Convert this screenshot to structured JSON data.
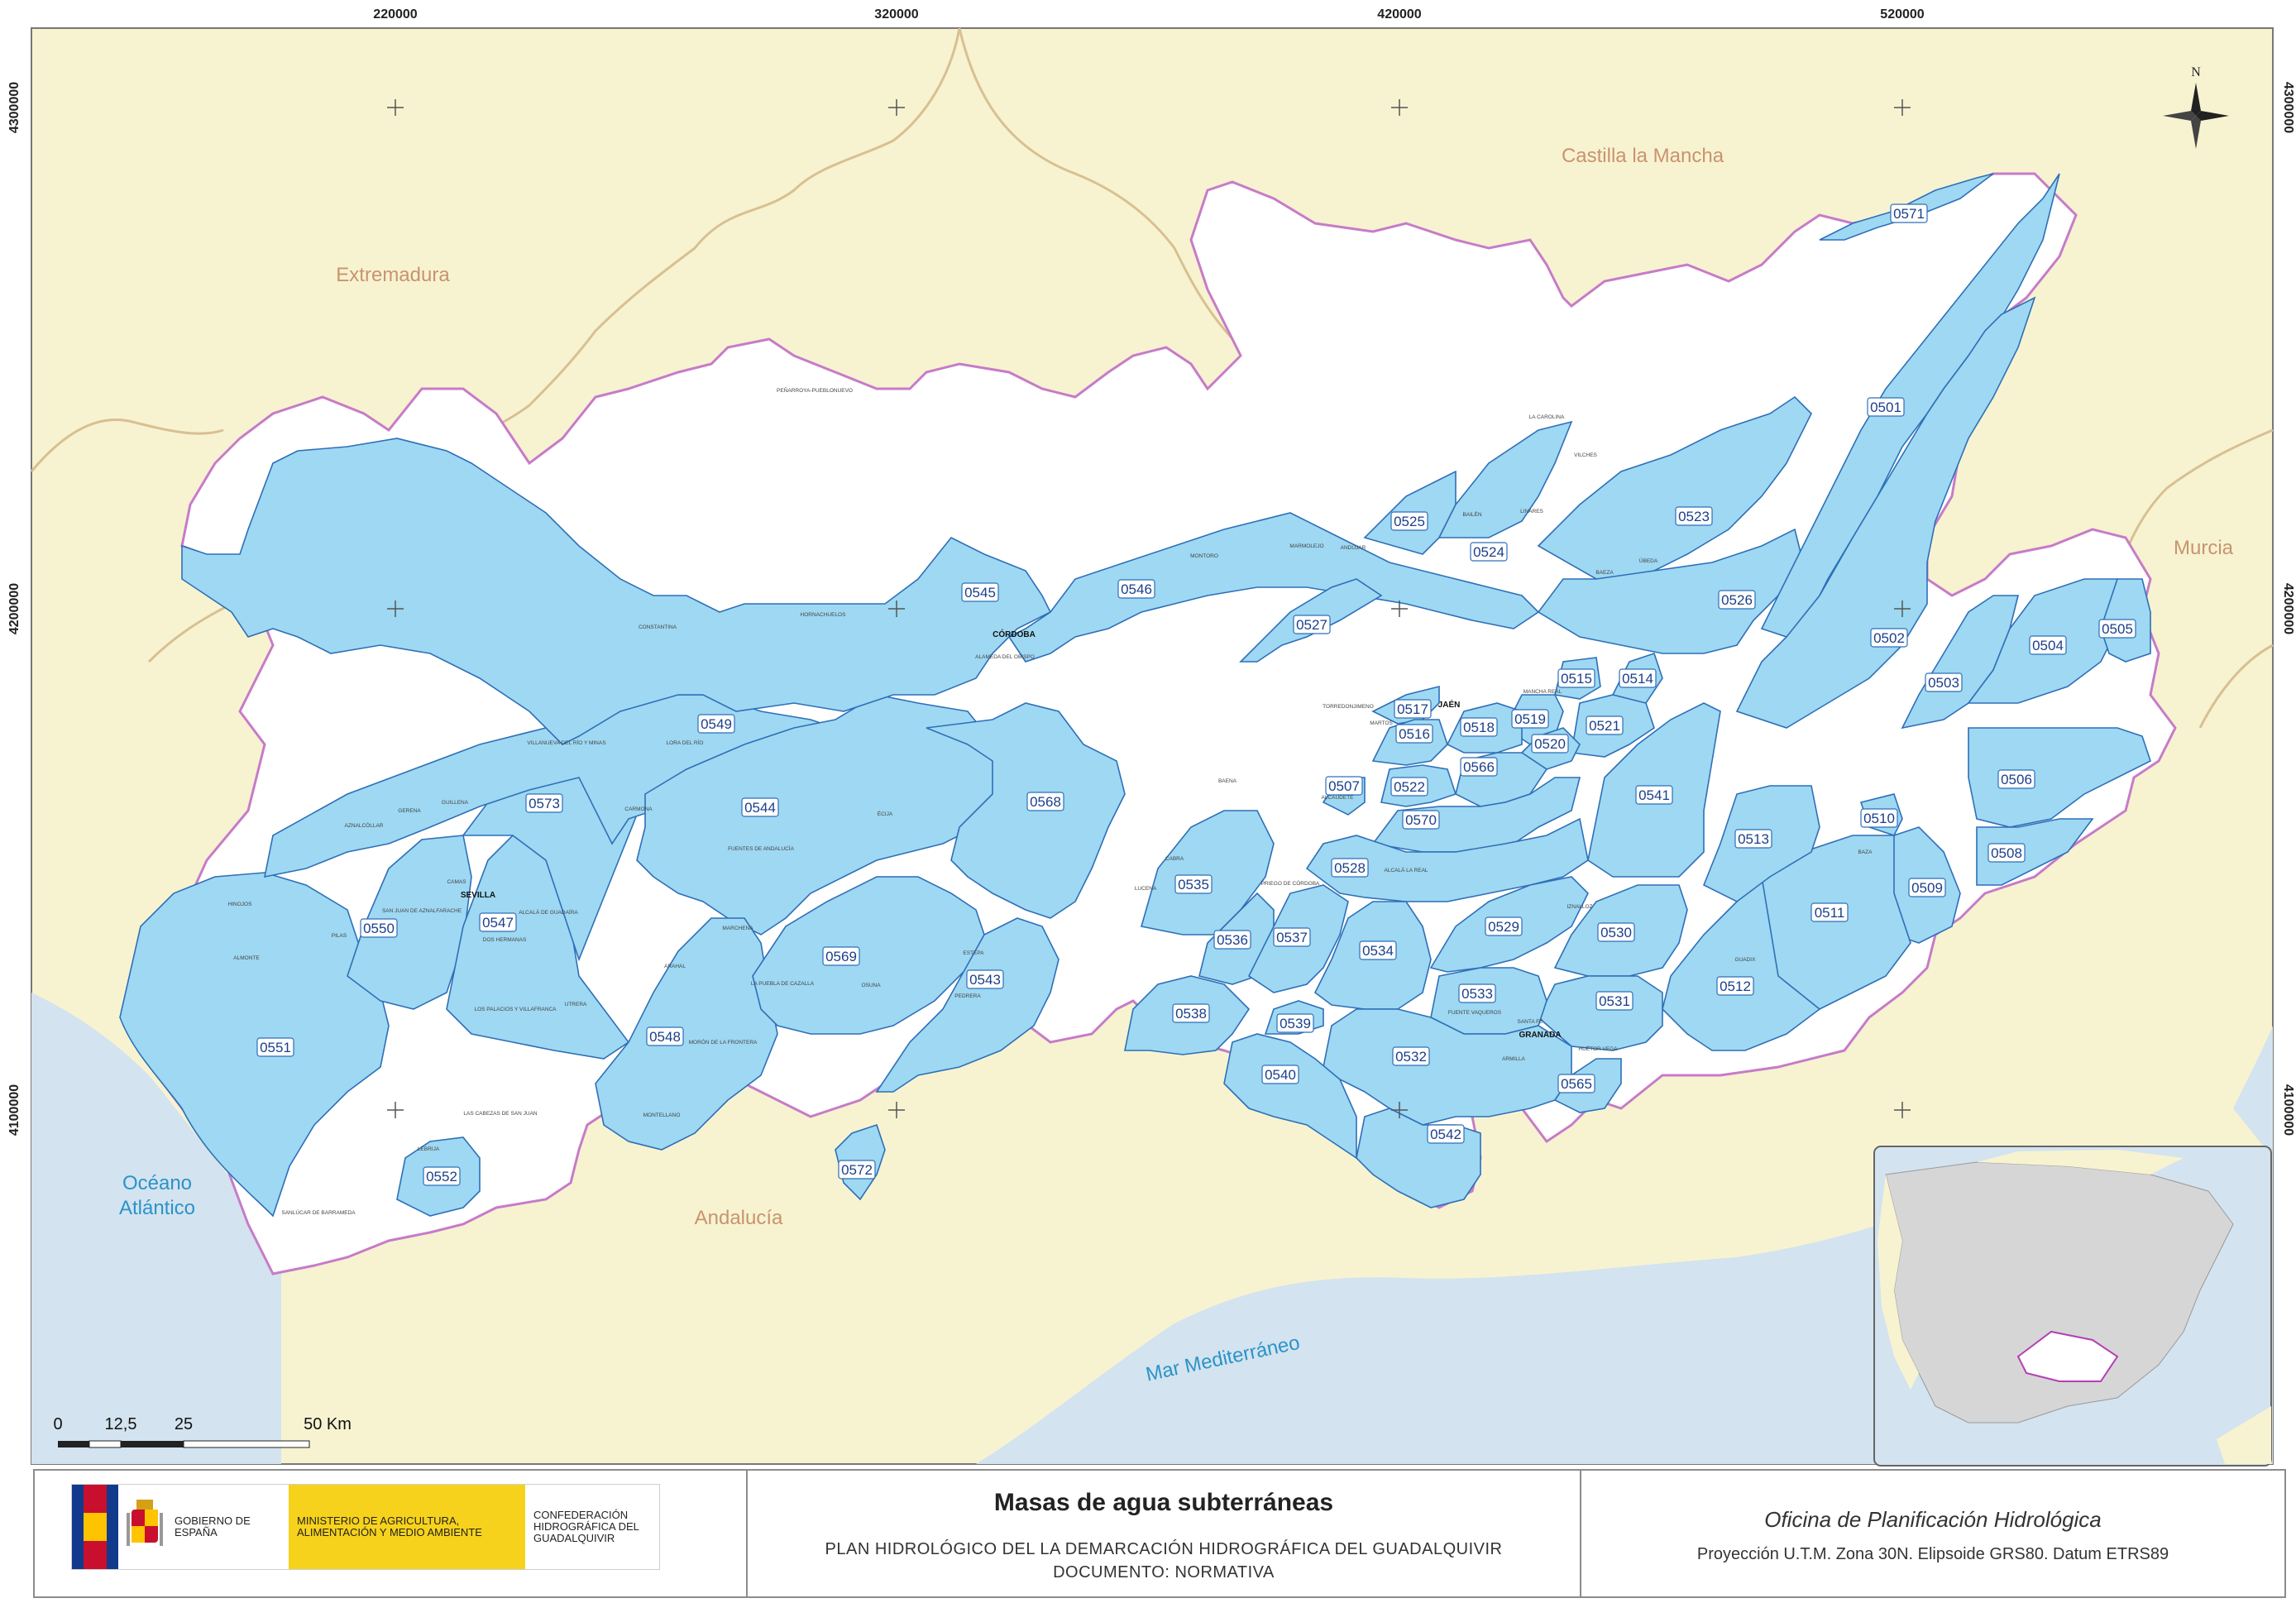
{
  "grid": {
    "eastings": [
      "220000",
      "320000",
      "420000",
      "520000"
    ],
    "northings": [
      "4300000",
      "4200000",
      "4100000"
    ]
  },
  "regions": {
    "extremadura": "Extremadura",
    "castilla": "Castilla la Mancha",
    "murcia": "Murcia",
    "andalucia": "Andalucía"
  },
  "seas": {
    "atlantico_1": "Océano",
    "atlantico_2": "Atlántico",
    "mediterraneo": "Mar Mediterráneo"
  },
  "north_label": "N",
  "cities": {
    "cordoba": "CÓRDOBA",
    "sevilla": "SEVILLA",
    "jaen": "JAÉN",
    "granada": "GRANADA"
  },
  "towns": {
    "penarroya": "PEÑARROYA-PUEBLONUEVO",
    "constantina": "CONSTANTINA",
    "hornachuelos": "HORNACHUELOS",
    "alameda": "ALAMEDA DEL OBISPO",
    "montoro": "MONTORO",
    "marmolejo": "MARMOLEJO",
    "andujar": "ANDÚJAR",
    "bailen": "BAILÉN",
    "linares": "LINARES",
    "carolina": "LA CAROLINA",
    "vilches": "VILCHES",
    "baeza": "BAEZA",
    "ubeda": "ÚBEDA",
    "torredonjimeno": "TORREDONJIMENO",
    "martos": "MARTOS",
    "mancha_real": "MANCHA REAL",
    "ecija": "ÉCIJA",
    "fuentes": "FUENTES DE ANDALUCÍA",
    "carmona": "CARMONA",
    "lora": "LORA DEL RÍO",
    "villanueva": "VILLANUEVA DEL RÍO Y MINAS",
    "gerena": "GERENA",
    "guillena": "GUILLENA",
    "aznalcollar": "AZNALCÓLLAR",
    "hinojos": "HINOJOS",
    "pilas": "PILAS",
    "almonte": "ALMONTE",
    "camas": "CAMAS",
    "san_juan": "SAN JUAN DE AZNALFARACHE",
    "alcala_guadaira": "ALCALÁ DE GUADAÍRA",
    "dos_hermanas": "DOS HERMANAS",
    "los_palacios": "LOS PALACIOS Y VILLAFRANCA",
    "utrera": "UTRERA",
    "arahal": "ARAHAL",
    "marchena": "MARCHENA",
    "osuna": "OSUNA",
    "estepa": "ESTEPA",
    "pedrera": "PEDRERA",
    "moron": "MORÓN DE LA FRONTERA",
    "montellano": "MONTELLANO",
    "cabezas": "LAS CABEZAS DE SAN JUAN",
    "lebrija": "LEBRIJA",
    "sanlucar": "SANLÚCAR DE BARRAMEDA",
    "cabra": "CABRA",
    "lucena": "LUCENA",
    "priego": "PRIEGO DE CÓRDOBA",
    "alcala_real": "ALCALÁ LA REAL",
    "iznalloz": "IZNALLOZ",
    "guadix": "GUADIX",
    "baza": "BAZA",
    "fuente_vaqueros": "FUENTE VAQUEROS",
    "santa_fe": "SANTA FE",
    "armilla": "ARMILLA",
    "huetor": "HUÉTOR VEGA",
    "alcaudete": "ALCAUDETE",
    "baena": "BAENA",
    "lantejuela": "LA PUEBLA DE CAZALLA"
  },
  "aquifer_codes": [
    "0571",
    "0501",
    "0502",
    "0503",
    "0504",
    "0505",
    "0506",
    "0508",
    "0509",
    "0510",
    "0511",
    "0512",
    "0513",
    "0514",
    "0515",
    "0516",
    "0517",
    "0518",
    "0519",
    "0520",
    "0521",
    "0522",
    "0523",
    "0524",
    "0525",
    "0526",
    "0527",
    "0528",
    "0529",
    "0530",
    "0531",
    "0532",
    "0533",
    "0534",
    "0535",
    "0536",
    "0537",
    "0538",
    "0539",
    "0540",
    "0541",
    "0542",
    "0543",
    "0544",
    "0545",
    "0546",
    "0547",
    "0548",
    "0549",
    "0550",
    "0551",
    "0552",
    "0565",
    "0566",
    "0568",
    "0569",
    "0570",
    "0572",
    "0573",
    "0507"
  ],
  "scale": {
    "labels": [
      "0",
      "12,5",
      "25",
      "50 Km"
    ]
  },
  "footer": {
    "gobierno": "GOBIERNO DE ESPAÑA",
    "ministerio": "MINISTERIO DE AGRICULTURA, ALIMENTACIÓN Y MEDIO AMBIENTE",
    "confederacion": "CONFEDERACIÓN HIDROGRÁFICA DEL GUADALQUIVIR",
    "title": "Masas de agua subterráneas",
    "plan": "PLAN HIDROLÓGICO DEL LA DEMARCACIÓN HIDROGRÁFICA DEL GUADALQUIVIR",
    "document": "DOCUMENTO: NORMATIVA",
    "office": "Oficina de Planificación Hidrológica",
    "projection": "Proyección U.T.M. Zona 30N. Elipsoide GRS80. Datum ETRS89"
  },
  "colors": {
    "land": "#f7f3d1",
    "sea": "#d3e3ef",
    "basin": "#ffffff",
    "aquifer": "#9ed8f2",
    "aquifer_border": "#2e6fb8",
    "basin_border": "#c77bc8",
    "region_border": "#d8c091",
    "region_text": "#c9936e",
    "sea_text": "#2b93c8"
  }
}
